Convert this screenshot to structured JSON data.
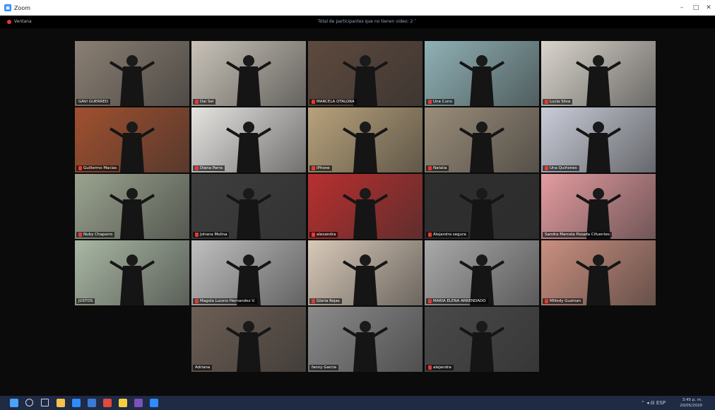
{
  "window": {
    "app_title": "Zoom",
    "minimize": "–",
    "maximize": "□",
    "close": "✕"
  },
  "meeting_bar": {
    "camera_status": "Ventana",
    "participants_label": "Total de participantes que no tienen video: 2  ˅"
  },
  "tiles": [
    {
      "name": "GAVI GUERREO",
      "bg": "#8a7f73",
      "mic_off": false,
      "active": true
    },
    {
      "name": "Dai Sel",
      "bg": "#c8c2b8",
      "mic_off": true
    },
    {
      "name": "MARCELA OTALORA",
      "bg": "#5e4a3e",
      "mic_off": true
    },
    {
      "name": "Una Cuno",
      "bg": "#8fb1b5",
      "mic_off": true
    },
    {
      "name": "Lucia Silva",
      "bg": "#d9d4cc",
      "mic_off": true
    },
    {
      "name": "Guillermo Macias",
      "bg": "#a0502f",
      "mic_off": true
    },
    {
      "name": "Diana Parra",
      "bg": "#e6e4e1",
      "mic_off": true
    },
    {
      "name": "iPhone",
      "bg": "#b8a27b",
      "mic_off": true
    },
    {
      "name": "Natalia",
      "bg": "#9a8d7a",
      "mic_off": true
    },
    {
      "name": "Una Quiñones",
      "bg": "#c9ccd8",
      "mic_off": true
    },
    {
      "name": "Nuby Chaparro",
      "bg": "#9aa38f",
      "mic_off": true
    },
    {
      "name": "Johana Molina",
      "bg": "#3e3e3e",
      "mic_off": true
    },
    {
      "name": "alexandra",
      "bg": "#b8302f",
      "mic_off": true
    },
    {
      "name": "Alejandra segura",
      "bg": "#2f2f2f",
      "mic_off": true
    },
    {
      "name": "Sandra Marcela Posada Cifuentes",
      "bg": "#e39ca0",
      "mic_off": false
    },
    {
      "name": "JUSTOS",
      "bg": "#a9b7a4",
      "mic_off": false
    },
    {
      "name": "Magola Lucero Hernandez V.",
      "bg": "#bfbfbf",
      "mic_off": true
    },
    {
      "name": "Gloria Rojas",
      "bg": "#d8c9b8",
      "mic_off": true
    },
    {
      "name": "MARIA ELENA ARRENDADO",
      "bg": "#a9a9a9",
      "mic_off": true
    },
    {
      "name": "Milledy Guzman",
      "bg": "#c98f7f",
      "mic_off": true
    },
    {
      "name": "Adriana",
      "bg": "#6c5e54",
      "mic_off": false
    },
    {
      "name": "fanny Garcia",
      "bg": "#8b8b8b",
      "mic_off": false
    },
    {
      "name": "alejandra",
      "bg": "#4a4a4a",
      "mic_off": true
    }
  ],
  "taskbar": {
    "icons": [
      {
        "name": "windows-start-icon",
        "color": "#4aa3ff"
      },
      {
        "name": "search-icon",
        "color": "#cfd6e6"
      },
      {
        "name": "task-view-icon",
        "color": "#cfd6e6"
      },
      {
        "name": "file-explorer-icon",
        "color": "#f2c14e"
      },
      {
        "name": "edge-icon",
        "color": "#2d8cff"
      },
      {
        "name": "store-icon",
        "color": "#3a7bd5"
      },
      {
        "name": "chrome-icon",
        "color": "#e24b3b"
      },
      {
        "name": "sticky-notes-icon",
        "color": "#f4d03f"
      },
      {
        "name": "slack-icon",
        "color": "#7b52b8"
      },
      {
        "name": "zoom-icon",
        "color": "#2d8cff"
      }
    ],
    "tray_icons": "⌃ ◂ ⊟ ESP",
    "time": "3:45 p. m.",
    "date": "20/05/2020"
  }
}
